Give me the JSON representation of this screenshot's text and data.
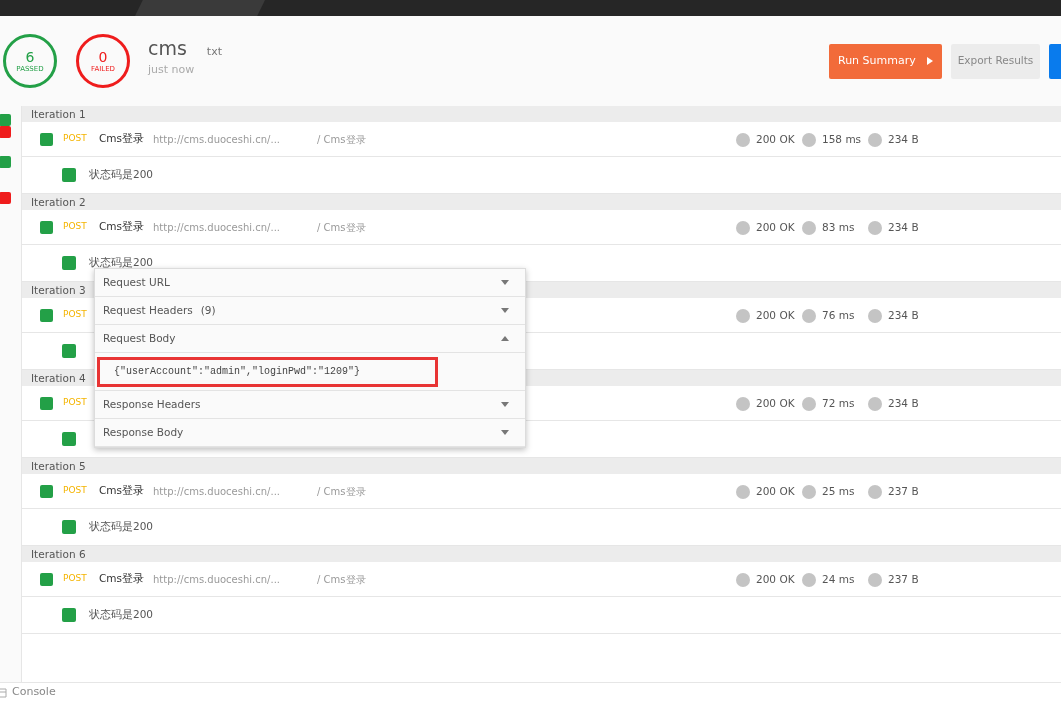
{
  "summary": {
    "passed": {
      "count": "6",
      "label": "PASSED"
    },
    "failed": {
      "count": "0",
      "label": "FAILED"
    },
    "name": "cms",
    "file_type": "txt",
    "time": "just now"
  },
  "buttons": [
    {
      "label": "Run Summary",
      "kind": "primary"
    },
    {
      "label": "Export Results",
      "kind": "secondary"
    },
    {
      "kind": "cut"
    }
  ],
  "sidebar_markers": [
    {
      "color": "#23a047"
    },
    {
      "color": "#ef1c1c"
    },
    {
      "color": "#23a047"
    },
    {
      "color": "#ef1c1c"
    }
  ],
  "iterations": [
    {
      "title": "Iteration 1",
      "request": {
        "method": "POST",
        "name": "Cms登录",
        "url": "http://cms.duoceshi.cn/...",
        "folder": "/ Cms登录",
        "status": "200 OK",
        "time": "158 ms",
        "size": "234 B"
      },
      "test": {
        "name": "状态码是200",
        "passed": true
      }
    },
    {
      "title": "Iteration 2",
      "request": {
        "method": "POST",
        "name": "Cms登录",
        "url": "http://cms.duoceshi.cn/...",
        "folder": "/ Cms登录",
        "status": "200 OK",
        "time": "83 ms",
        "size": "234 B"
      },
      "test": {
        "name": "状态码是200",
        "passed": true
      }
    },
    {
      "title": "Iteration 3",
      "request": {
        "method": "POST",
        "status": "200 OK",
        "time": "76 ms",
        "size": "234 B"
      },
      "test": {
        "passed": true
      }
    },
    {
      "title": "Iteration 4",
      "request": {
        "method": "POST",
        "status": "200 OK",
        "time": "72 ms",
        "size": "234 B"
      },
      "test": {
        "passed": true
      }
    },
    {
      "title": "Iteration 5",
      "request": {
        "method": "POST",
        "name": "Cms登录",
        "url": "http://cms.duoceshi.cn/...",
        "folder": "/ Cms登录",
        "status": "200 OK",
        "time": "25 ms",
        "size": "237 B"
      },
      "test": {
        "name": "状态码是200",
        "passed": true
      }
    },
    {
      "title": "Iteration 6",
      "request": {
        "method": "POST",
        "name": "Cms登录",
        "url": "http://cms.duoceshi.cn/...",
        "folder": "/ Cms登录",
        "status": "200 OK",
        "time": "24 ms",
        "size": "237 B"
      },
      "test": {
        "name": "状态码是200",
        "passed": true
      }
    }
  ],
  "details_popup": {
    "sections": [
      {
        "title": "Request URL",
        "expanded": false
      },
      {
        "title": "Request Headers",
        "count": "(9)",
        "expanded": false
      },
      {
        "title": "Request Body",
        "expanded": true,
        "body": "{\"userAccount\":\"admin\",\"loginPwd\":\"1209\"}",
        "highlighted": true
      },
      {
        "title": "Response Headers",
        "expanded": false
      },
      {
        "title": "Response Body",
        "expanded": false
      }
    ]
  },
  "footer": {
    "label": "Console"
  }
}
